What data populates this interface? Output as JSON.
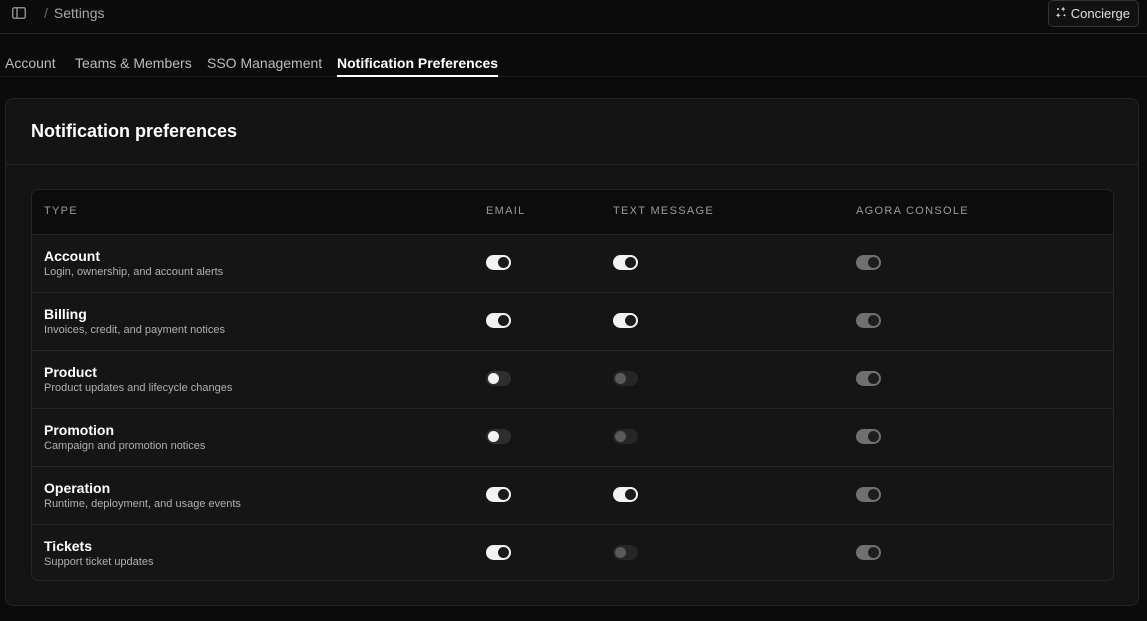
{
  "topbar": {
    "breadcrumb_sep": "/",
    "breadcrumb_current": "Settings",
    "concierge_label": "Concierge"
  },
  "tabs": [
    {
      "label": "Account",
      "active": false
    },
    {
      "label": "Teams & Members",
      "active": false
    },
    {
      "label": "SSO Management",
      "active": false
    },
    {
      "label": "Notification Preferences",
      "active": true
    }
  ],
  "card": {
    "title": "Notification preferences"
  },
  "table": {
    "headers": {
      "type": "TYPE",
      "email": "EMAIL",
      "text": "TEXT MESSAGE",
      "console": "AGORA CONSOLE"
    },
    "rows": [
      {
        "name": "Account",
        "desc": "Login, ownership, and account alerts",
        "email": "on",
        "text": "on",
        "console": "dis-on"
      },
      {
        "name": "Billing",
        "desc": "Invoices, credit, and payment notices",
        "email": "on",
        "text": "on",
        "console": "dis-on"
      },
      {
        "name": "Product",
        "desc": "Product updates and lifecycle changes",
        "email": "off",
        "text": "dis-off",
        "console": "dis-on"
      },
      {
        "name": "Promotion",
        "desc": "Campaign and promotion notices",
        "email": "off",
        "text": "dis-off",
        "console": "dis-on"
      },
      {
        "name": "Operation",
        "desc": "Runtime, deployment, and usage events",
        "email": "on",
        "text": "on",
        "console": "dis-on"
      },
      {
        "name": "Tickets",
        "desc": "Support ticket updates",
        "email": "on",
        "text": "dis-off",
        "console": "dis-on"
      }
    ]
  },
  "icons": {
    "sidebar_toggle": "sidebar-toggle-icon",
    "concierge": "sparkle-icon"
  }
}
